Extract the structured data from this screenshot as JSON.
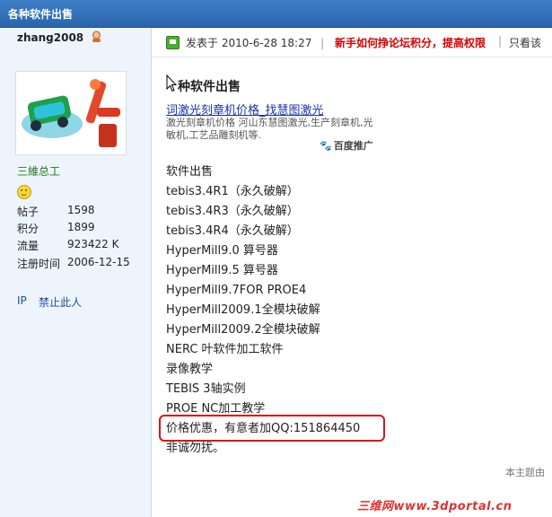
{
  "header": {
    "title": "各种软件出售"
  },
  "author": {
    "username": "zhang2008",
    "rank": "三維总工",
    "stats": [
      {
        "label": "帖子",
        "value": "1598"
      },
      {
        "label": "积分",
        "value": "1899"
      },
      {
        "label": "流量",
        "value": "923422 K"
      },
      {
        "label": "注册时间",
        "value": "2006-12-15"
      }
    ],
    "links": {
      "ip": "IP",
      "ban": "禁止此人"
    }
  },
  "post": {
    "posted_label": "发表于",
    "posted_time": "2010-6-28 18:27",
    "promo": "新手如何挣论坛积分，提高权限",
    "view_only": "只看该",
    "subject": "种软件出售",
    "ad": {
      "title": "词激光刻章机价格_找慧图激光",
      "description": "激光刻章机价格 河山东慧图激光,生产刻章机,光敏机,工艺品雕刻机等.",
      "badge": "百度推广"
    },
    "lines": [
      "软件出售",
      "tebis3.4R1（永久破解）",
      "tebis3.4R3（永久破解）",
      "tebis3.4R4（永久破解）",
      "HyperMill9.0 算号器",
      "HyperMill9.5 算号器",
      "HyperMill9.7FOR PROE4",
      "HyperMill2009.1全模块破解",
      "HyperMill2009.2全模块破解",
      "NERC  叶软件加工软件",
      "录像教学",
      "TEBIS 3轴实例",
      "PROE  NC加工教学",
      "价格优惠，有意者加QQ:151864450",
      "非诚勿扰。"
    ],
    "footnote": "本主题由"
  },
  "watermark": "三维网www.3dportal.cn",
  "colors": {
    "topbar": "#2f6db5",
    "sidebar": "#eef4fb",
    "promo": "#d40000",
    "highlight": "#d8151a",
    "ad_link": "#1a33a8"
  }
}
